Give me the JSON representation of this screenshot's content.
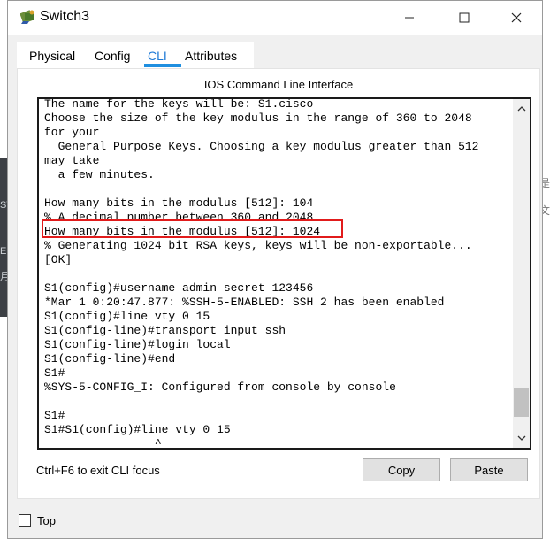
{
  "window": {
    "title": "Switch3"
  },
  "tabs": [
    {
      "label": "Physical"
    },
    {
      "label": "Config"
    },
    {
      "label": "CLI"
    },
    {
      "label": "Attributes"
    }
  ],
  "active_tab": "CLI",
  "panel": {
    "title": "IOS Command Line Interface"
  },
  "terminal": {
    "lines": [
      "The name for the keys will be: S1.cisco",
      "Choose the size of the key modulus in the range of 360 to 2048",
      "for your",
      "  General Purpose Keys. Choosing a key modulus greater than 512",
      "may take",
      "  a few minutes.",
      "",
      "How many bits in the modulus [512]: 104",
      "% A decimal number between 360 and 2048.",
      "How many bits in the modulus [512]: 1024",
      "% Generating 1024 bit RSA keys, keys will be non-exportable...",
      "[OK]",
      "",
      "S1(config)#username admin secret 123456",
      "*Mar 1 0:20:47.877: %SSH-5-ENABLED: SSH 2 has been enabled",
      "S1(config)#line vty 0 15",
      "S1(config-line)#transport input ssh",
      "S1(config-line)#login local",
      "S1(config-line)#end",
      "S1#",
      "%SYS-5-CONFIG_I: Configured from console by console",
      "",
      "S1#",
      "S1#S1(config)#line vty 0 15",
      "                ^"
    ],
    "highlighted_line": "How many bits in the modulus [512]: 1024"
  },
  "footer": {
    "hint": "Ctrl+F6 to exit CLI focus",
    "copy_label": "Copy",
    "paste_label": "Paste"
  },
  "top_checkbox": {
    "label": "Top",
    "checked": false
  },
  "background": {
    "left_chars": [
      "SV",
      "E",
      "月"
    ],
    "right_chars": [
      "是",
      "文"
    ]
  },
  "colors": {
    "accent": "#1f8fe0",
    "highlight_border": "#e11b1b"
  }
}
